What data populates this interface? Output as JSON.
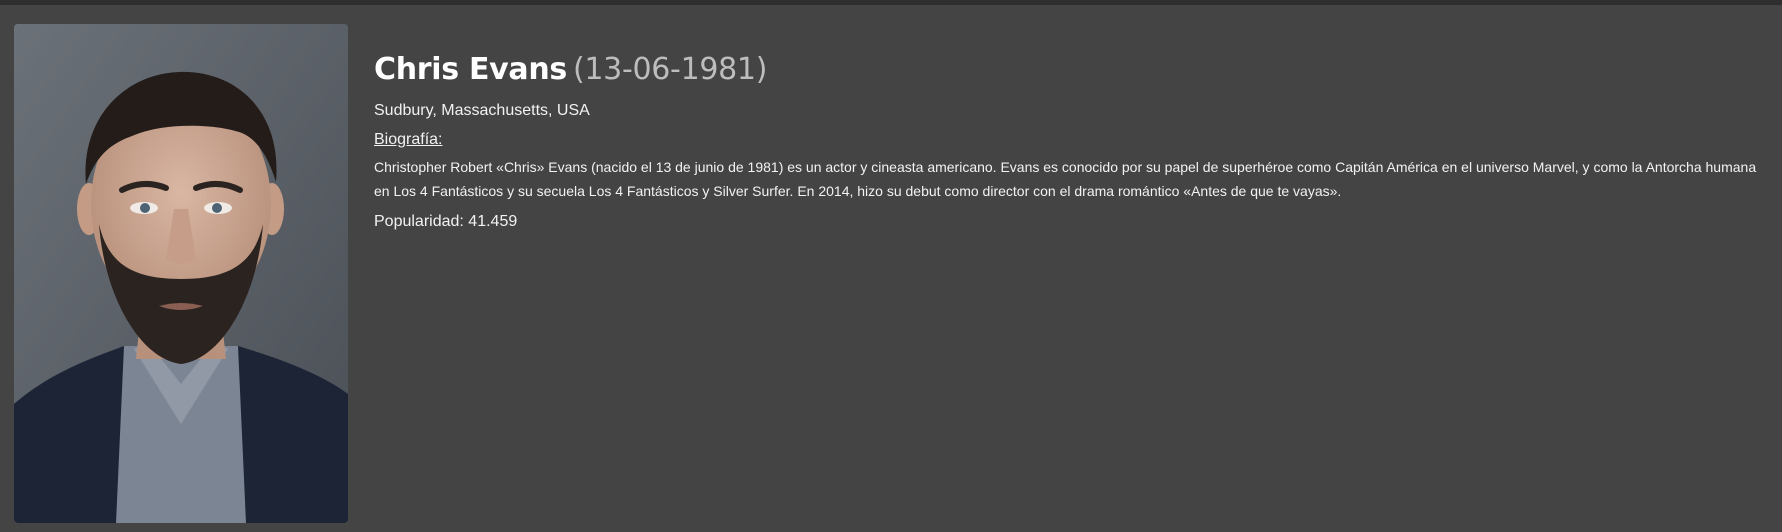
{
  "person": {
    "name": "Chris Evans",
    "birth_date": "(13-06-1981)",
    "birthplace": "Sudbury, Massachusetts, USA",
    "biography_heading": "Biografía:",
    "biography": "Christopher Robert «Chris» Evans (nacido el 13 de junio de 1981) es un actor y cineasta americano. Evans es conocido por su papel de superhéroe como Capitán América en el universo Marvel, y como la Antorcha humana en Los 4 Fantásticos y su secuela Los 4 Fantásticos y Silver Surfer. En 2014, hizo su debut como director con el drama romántico «Antes de que te vayas».",
    "popularity_label": "Popularidad:",
    "popularity_value": "41.459"
  },
  "colors": {
    "page_background": "#444444",
    "top_bar": "#2e2e2e",
    "text": "#f2f2f2",
    "date_text": "#bdbdbd"
  }
}
